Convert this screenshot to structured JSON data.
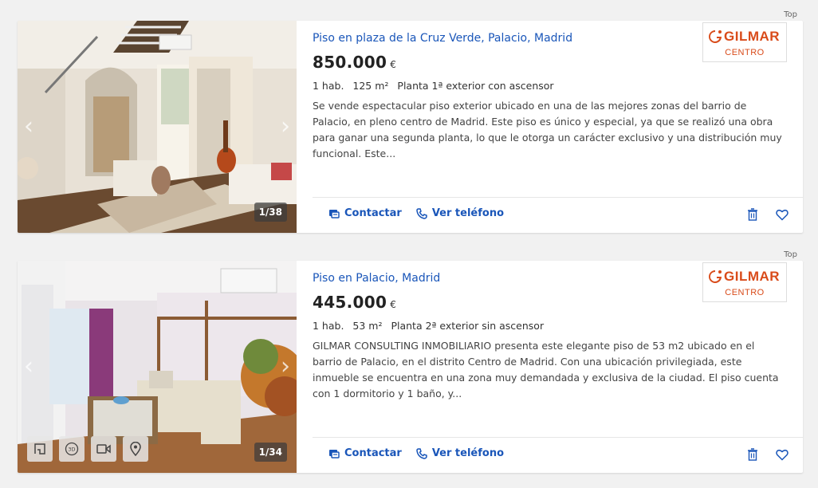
{
  "listings": [
    {
      "badge": "Top",
      "title": "Piso en plaza de la Cruz Verde, Palacio, Madrid",
      "price": "850.000",
      "currency": "€",
      "rooms": "1 hab.",
      "area": "125 m²",
      "floor": "Planta 1ª exterior con ascensor",
      "description": "Se vende espectacular piso exterior ubicado en una de las mejores zonas del barrio de Palacio, en pleno centro de Madrid. Este piso es único y especial, ya que se realizó una obra para ganar una segunda planta, lo que le otorga un carácter exclusivo y una distribución muy funcional. Este...",
      "photo_counter": "1/38",
      "logo_brand": "GILMAR",
      "logo_sub": "CENTRO",
      "contact_label": "Contactar",
      "phone_label": "Ver teléfono"
    },
    {
      "badge": "Top",
      "title": "Piso en Palacio, Madrid",
      "price": "445.000",
      "currency": "€",
      "rooms": "1 hab.",
      "area": "53 m²",
      "floor": "Planta 2ª exterior sin ascensor",
      "description": "GILMAR CONSULTING INMOBILIARIO presenta este elegante piso de 53 m2 ubicado en el barrio de Palacio, en el distrito Centro de Madrid. Con una ubicación privilegiada, este inmueble se encuentra en una zona muy demandada y exclusiva de la ciudad. El piso cuenta con 1 dormitorio y 1 baño, y...",
      "photo_counter": "1/34",
      "logo_brand": "GILMAR",
      "logo_sub": "CENTRO",
      "contact_label": "Contactar",
      "phone_label": "Ver teléfono",
      "media_icons": [
        "floorplan-icon",
        "3d-tour-icon",
        "video-icon",
        "map-pin-icon"
      ]
    }
  ],
  "colors": {
    "link": "#1a56b9",
    "brand": "#d94b1a",
    "page_bg": "#f1f1f1"
  }
}
